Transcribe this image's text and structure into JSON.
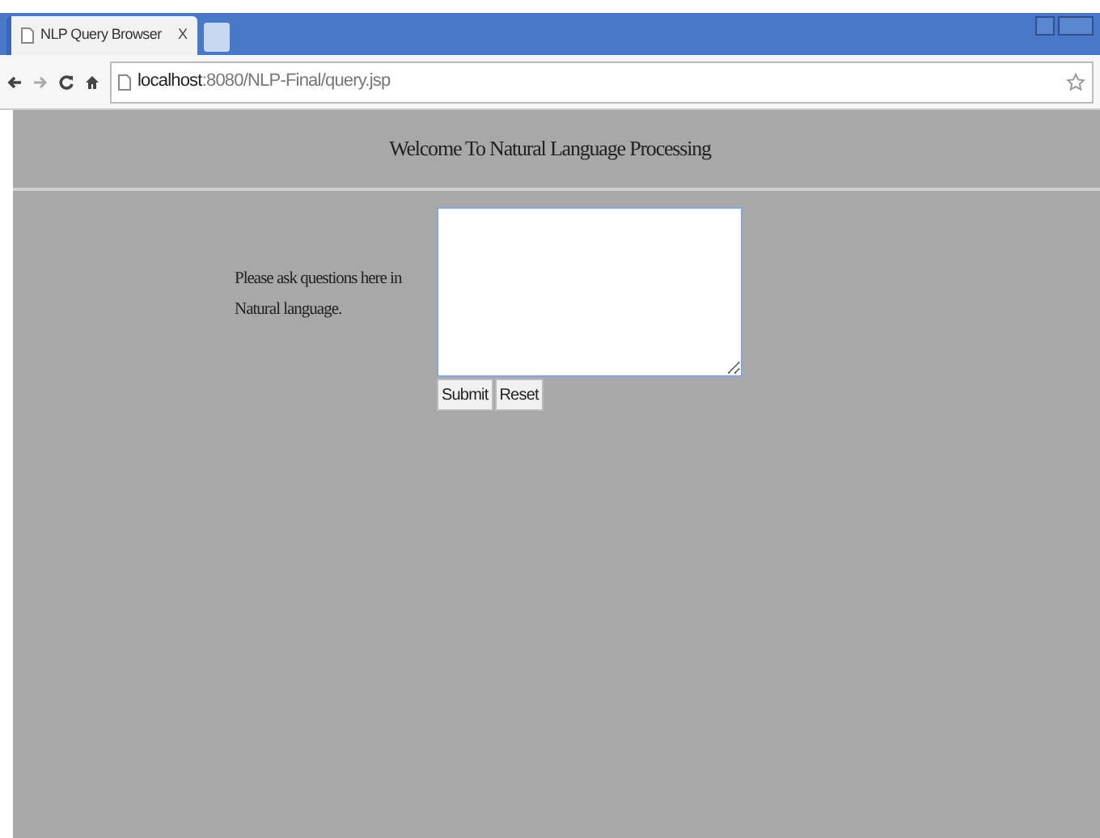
{
  "tab": {
    "title": "NLP Query Browser",
    "close": "X"
  },
  "address": {
    "host": "localhost",
    "path": ":8080/NLP-Final/query.jsp"
  },
  "page": {
    "heading": "Welcome To Natural Language Processing",
    "prompt": "Please ask questions here in Natural language.",
    "buttons": [
      "Submit",
      "Reset"
    ]
  }
}
